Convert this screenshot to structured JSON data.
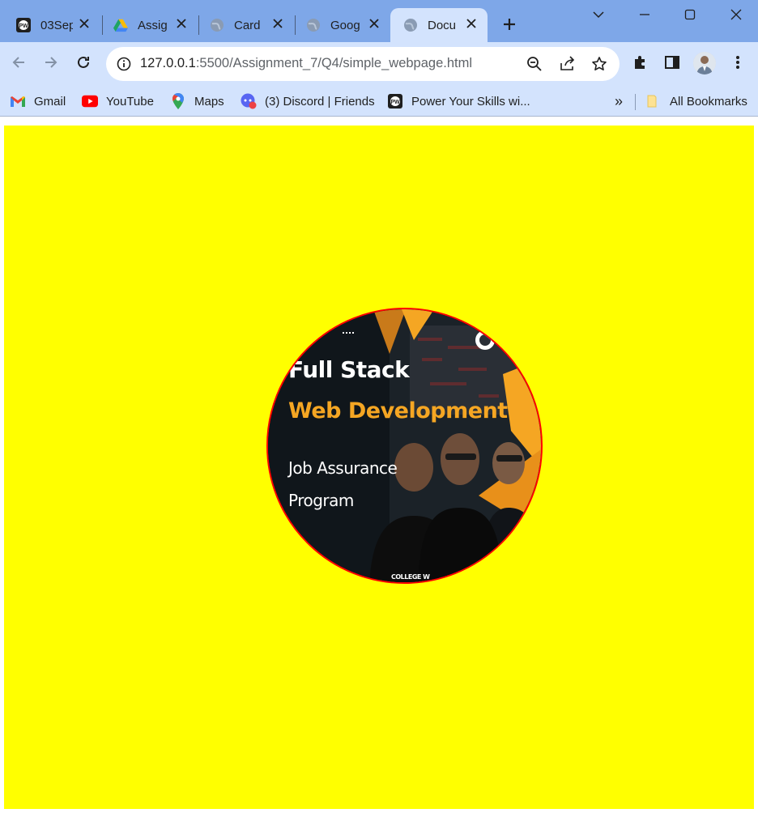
{
  "browser": {
    "tabs": [
      {
        "title": "03Sep",
        "favicon": "pw-logo-icon",
        "active": false
      },
      {
        "title": "Assig",
        "favicon": "google-drive-icon",
        "active": false
      },
      {
        "title": "Card",
        "favicon": "globe-icon",
        "active": false
      },
      {
        "title": "Goog",
        "favicon": "globe-icon",
        "active": false
      },
      {
        "title": "Docu",
        "favicon": "globe-icon",
        "active": true
      }
    ],
    "url_host": "127.0.0.1",
    "url_path": ":5500/Assignment_7/Q4/simple_webpage.html",
    "bookmarks": [
      {
        "label": "Gmail",
        "icon": "gmail-icon"
      },
      {
        "label": "YouTube",
        "icon": "youtube-icon"
      },
      {
        "label": "Maps",
        "icon": "maps-icon"
      },
      {
        "label": "(3) Discord | Friends",
        "icon": "discord-icon"
      },
      {
        "label": "Power Your Skills wi...",
        "icon": "pw-logo-icon"
      }
    ],
    "overflow_label": "»",
    "all_bookmarks_label": "All Bookmarks"
  },
  "page": {
    "background": "#ffff00",
    "circle_border_color": "#ff0000",
    "thumbnail": {
      "line1": "Full Stack",
      "line2": "Web Development",
      "line3": "Job Assurance",
      "line4": "Program",
      "badge_text": "COLLEGE W",
      "accent_color": "#f5a623"
    }
  }
}
